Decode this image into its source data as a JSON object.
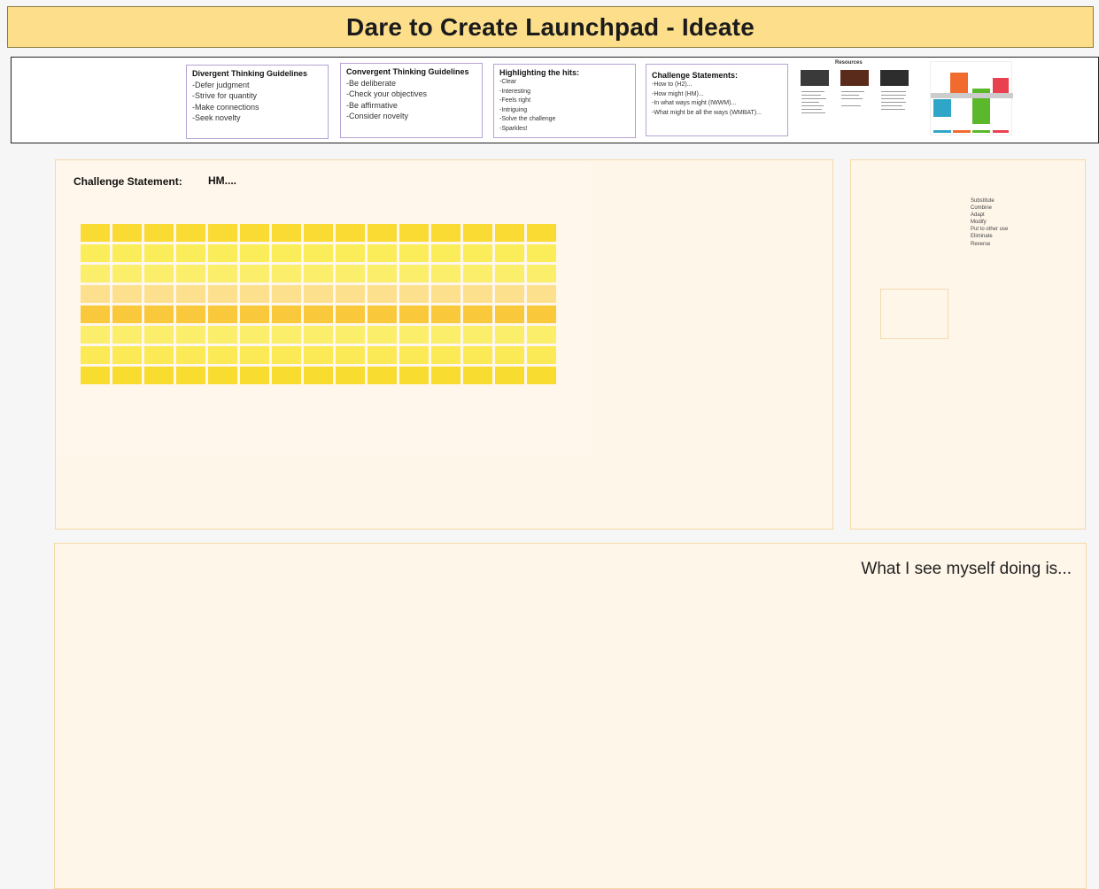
{
  "header": {
    "title": "Dare to Create Launchpad - Ideate"
  },
  "guidelines": {
    "divergent": {
      "title": "Divergent Thinking Guidelines",
      "items": [
        "-Defer judgment",
        "-Strive for quantity",
        "-Make connections",
        "-Seek novelty"
      ]
    },
    "convergent": {
      "title": "Convergent Thinking Guidelines",
      "items": [
        "-Be deliberate",
        "-Check your objectives",
        "-Be affirmative",
        "-Consider novelty"
      ]
    },
    "highlighting": {
      "title": "Highlighting the hits:",
      "items": [
        "-Clear",
        "-Interesting",
        "-Feels right",
        "-Intriguing",
        "-Solve the challenge",
        "-Sparkles!"
      ]
    },
    "challenge_statements": {
      "title": "Challenge Statements:",
      "items": [
        "-How to (H2)...",
        "-How might (HM)...",
        "-In what ways might (IWWM)...",
        "-What might be all the ways (WMBAT)..."
      ]
    },
    "resources_label": "Resources"
  },
  "ideate": {
    "challenge_label": "Challenge Statement:",
    "challenge_value": "HM....",
    "sticky_row_colors": [
      "#f9db33",
      "#fbec5a",
      "#fbee6a",
      "#fde08e",
      "#f9c93b",
      "#fbee6a",
      "#fbea55",
      "#f9dc30"
    ],
    "sticky_columns": 15
  },
  "scamper": {
    "items": [
      "Substitute",
      "Combine",
      "Adapt",
      "Modify",
      "Put to other use",
      "Eliminate",
      "Reverse"
    ]
  },
  "vision": {
    "prompt": "What I see myself doing is..."
  },
  "colors": {
    "banner": "#fcde8b",
    "panel_bg": "#fff6ea",
    "card_border": "#b6a2d4"
  }
}
